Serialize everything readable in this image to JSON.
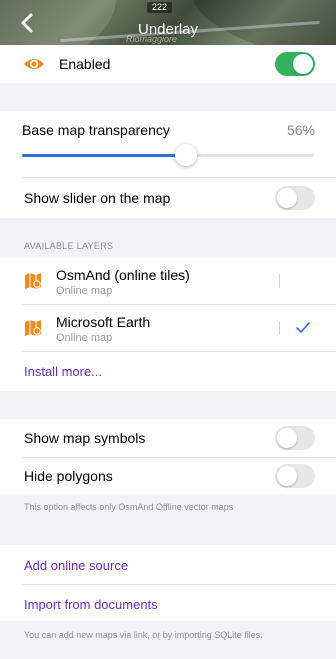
{
  "header": {
    "title": "Underlay",
    "map_badge": "222",
    "map_label": "Riomaggiore"
  },
  "enabled": {
    "label": "Enabled",
    "state": true
  },
  "transparency": {
    "label": "Base map transparency",
    "value_text": "56%",
    "value": 0.56
  },
  "show_slider": {
    "label": "Show slider on the map",
    "state": false
  },
  "layers": {
    "section_title": "AVAILABLE LAYERS",
    "items": [
      {
        "name": "OsmAnd (online tiles)",
        "type": "Online map",
        "selected": false
      },
      {
        "name": "Microsoft Earth",
        "type": "Online map",
        "selected": true
      }
    ],
    "install_more": "Install more..."
  },
  "map_symbols": {
    "label": "Show map symbols",
    "state": false
  },
  "hide_polygons": {
    "label": "Hide polygons",
    "state": false
  },
  "polygons_note": "This option affects only OsmAnd Offline vector maps",
  "add_online_source": "Add online source",
  "import_from_documents": "Import from documents",
  "footer_note": "You can add new maps via link, or by importing SQLite files.",
  "colors": {
    "accent": "#6a2ed6",
    "switch_on": "#33b15d",
    "slider": "#2f6fd6",
    "layer_icon": "#f08a1c"
  }
}
